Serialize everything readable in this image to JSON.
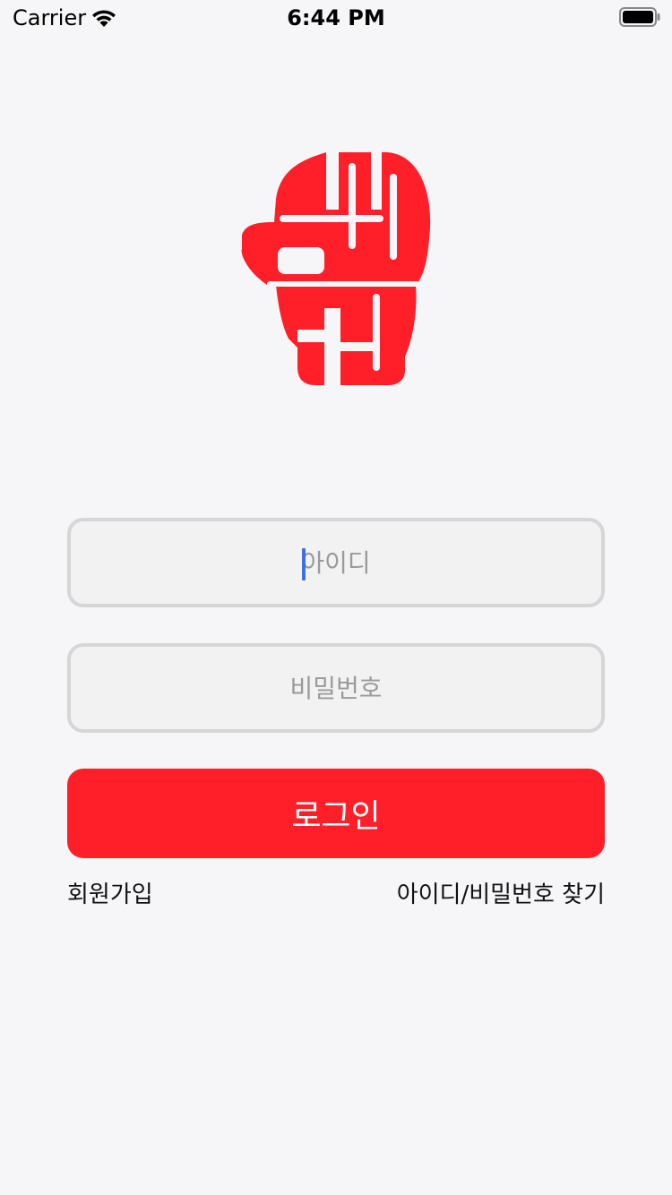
{
  "status_bar": {
    "carrier": "Carrier",
    "time": "6:44 PM",
    "icons": [
      "wifi-icon",
      "battery-icon"
    ]
  },
  "brand": {
    "logo_icon": "brand-logo-icon",
    "color": "#ff1f29"
  },
  "form": {
    "id_placeholder": "아이디",
    "id_value": "",
    "password_placeholder": "비밀번호",
    "password_value": "",
    "login_label": "로그인"
  },
  "links": {
    "signup": "회원가입",
    "find_account": "아이디/비밀번호 찾기"
  },
  "colors": {
    "accent": "#ff1f29",
    "field_bg": "#f2f2f2",
    "field_border": "#d6d6d6",
    "caret": "#3f6fe0"
  }
}
